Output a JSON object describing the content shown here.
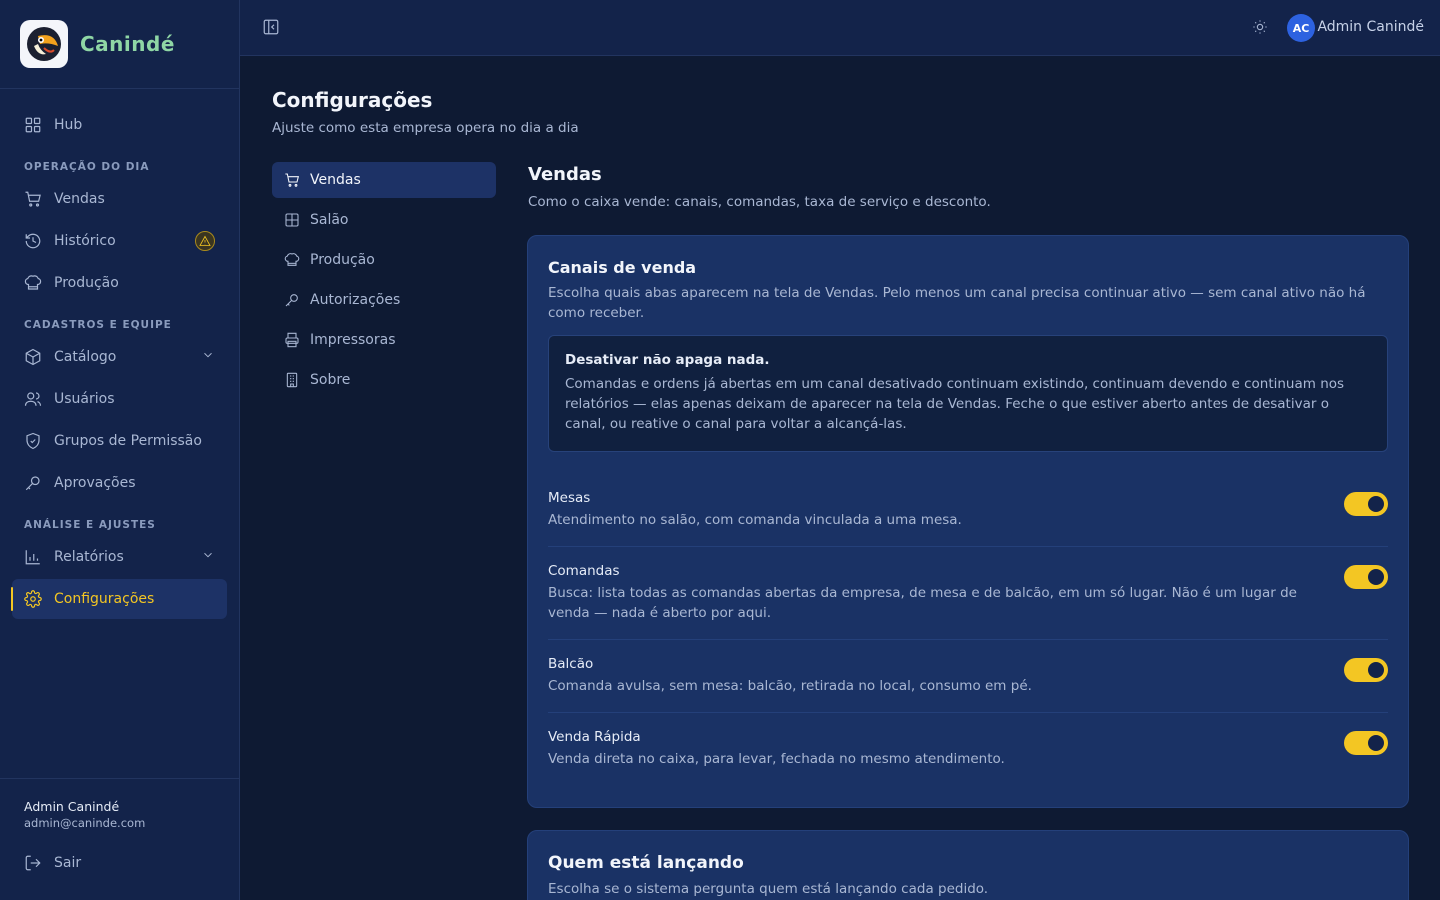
{
  "brand": {
    "name": "Canindé"
  },
  "sidebar": {
    "hub": "Hub",
    "section1": "OPERAÇÃO DO DIA",
    "vendas": "Vendas",
    "historico": "Histórico",
    "producao": "Produção",
    "section2": "CADASTROS E EQUIPE",
    "catalogo": "Catálogo",
    "usuarios": "Usuários",
    "grupos": "Grupos de Permissão",
    "aprovacoes": "Aprovações",
    "section3": "ANÁLISE E AJUSTES",
    "relatorios": "Relatórios",
    "configuracoes": "Configurações",
    "user_name": "Admin Canindé",
    "user_email": "admin@caninde.com",
    "logout": "Sair"
  },
  "topbar": {
    "avatar_initials": "AC",
    "user_name": "Admin Canindé"
  },
  "page": {
    "title": "Configurações",
    "subtitle": "Ajuste como esta empresa opera no dia a dia"
  },
  "settings_nav": {
    "vendas": "Vendas",
    "salao": "Salão",
    "producao": "Produção",
    "autorizacoes": "Autorizações",
    "impressoras": "Impressoras",
    "sobre": "Sobre"
  },
  "section": {
    "title": "Vendas",
    "subtitle": "Como o caixa vende: canais, comandas, taxa de serviço e desconto."
  },
  "channels_card": {
    "title": "Canais de venda",
    "description": "Escolha quais abas aparecem na tela de Vendas. Pelo menos um canal precisa continuar ativo — sem canal ativo não há como receber.",
    "notice_title": "Desativar não apaga nada.",
    "notice_body": "Comandas e ordens já abertas em um canal desativado continuam existindo, continuam devendo e continuam nos relatórios — elas apenas deixam de aparecer na tela de Vendas. Feche o que estiver aberto antes de desativar o canal, ou reative o canal para voltar a alcançá-las.",
    "channels": [
      {
        "name": "Mesas",
        "desc": "Atendimento no salão, com comanda vinculada a uma mesa.",
        "enabled": true
      },
      {
        "name": "Comandas",
        "desc": "Busca: lista todas as comandas abertas da empresa, de mesa e de balcão, em um só lugar. Não é um lugar de venda — nada é aberto por aqui.",
        "enabled": true
      },
      {
        "name": "Balcão",
        "desc": "Comanda avulsa, sem mesa: balcão, retirada no local, consumo em pé.",
        "enabled": true
      },
      {
        "name": "Venda Rápida",
        "desc": "Venda direta no caixa, para levar, fechada no mesmo atendimento.",
        "enabled": true
      }
    ]
  },
  "launcher_card": {
    "title": "Quem está lançando",
    "description": "Escolha se o sistema pergunta quem está lançando cada pedido."
  },
  "colors": {
    "accent": "#f3c623",
    "sidebar_bg": "#13234a",
    "card_bg": "#1a3265",
    "avatar": "#2d62e0"
  }
}
